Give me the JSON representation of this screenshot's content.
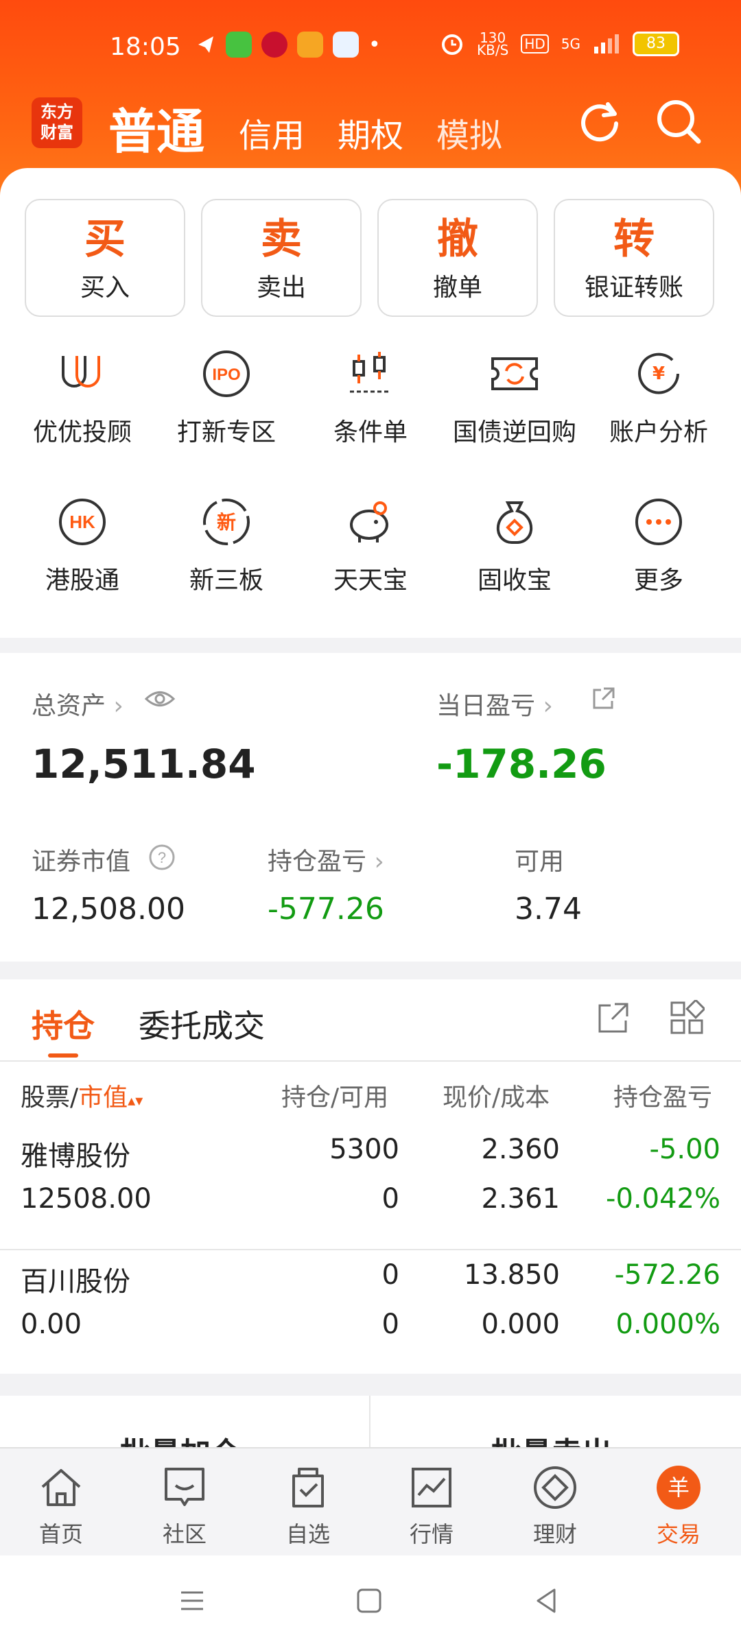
{
  "status_bar": {
    "time": "18:05",
    "net_speed_top": "130",
    "net_speed_unit": "KB/S",
    "hd": "HD",
    "signal": "5G",
    "battery": "83"
  },
  "topnav": {
    "logo": "东方财富",
    "tabs": [
      "普通",
      "信用",
      "期权",
      "模拟"
    ]
  },
  "actions": [
    {
      "big": "买",
      "label": "买入"
    },
    {
      "big": "卖",
      "label": "卖出"
    },
    {
      "big": "撤",
      "label": "撤单"
    },
    {
      "big": "转",
      "label": "银证转账"
    }
  ],
  "features_row1": [
    {
      "label": "优优投顾",
      "icon": "uu-advisor-icon"
    },
    {
      "label": "打新专区",
      "icon": "ipo-icon"
    },
    {
      "label": "条件单",
      "icon": "condition-order-icon"
    },
    {
      "label": "国债逆回购",
      "icon": "reverse-repo-icon"
    },
    {
      "label": "账户分析",
      "icon": "account-analysis-icon"
    }
  ],
  "features_row2": [
    {
      "label": "港股通",
      "icon": "hk-icon"
    },
    {
      "label": "新三板",
      "icon": "new-third-board-icon"
    },
    {
      "label": "天天宝",
      "icon": "piggy-bank-icon"
    },
    {
      "label": "固收宝",
      "icon": "money-bag-icon"
    },
    {
      "label": "更多",
      "icon": "more-icon"
    }
  ],
  "assets": {
    "total_label": "总资产",
    "total_value": "12,511.84",
    "daily_pl_label": "当日盈亏",
    "daily_pl_value": "-178.26",
    "market_value_label": "证券市值",
    "market_value": "12,508.00",
    "holding_pl_label": "持仓盈亏",
    "holding_pl": "-577.26",
    "available_label": "可用",
    "available": "3.74"
  },
  "positions": {
    "tabs": [
      "持仓",
      "委托成交"
    ],
    "headers": {
      "stock": "股票",
      "slash": "/",
      "market_value": "市值",
      "holding": "持仓/可用",
      "price": "现价/成本",
      "pl": "持仓盈亏"
    },
    "rows": [
      {
        "name": "雅博股份",
        "market_value": "12508.00",
        "holding": "5300",
        "available": "0",
        "price": "2.360",
        "cost": "2.361",
        "pl": "-5.00",
        "pl_pct": "-0.042%"
      },
      {
        "name": "百川股份",
        "market_value": "0.00",
        "holding": "0",
        "available": "0",
        "price": "13.850",
        "cost": "0.000",
        "pl": "-572.26",
        "pl_pct": "0.000%"
      }
    ]
  },
  "batch": {
    "left": "批量加仓",
    "right": "批量卖出"
  },
  "bottom_nav": [
    {
      "label": "首页",
      "icon": "home-icon"
    },
    {
      "label": "社区",
      "icon": "community-icon"
    },
    {
      "label": "自选",
      "icon": "watchlist-icon"
    },
    {
      "label": "行情",
      "icon": "market-icon"
    },
    {
      "label": "理财",
      "icon": "wealth-icon"
    },
    {
      "label": "交易",
      "icon": "trade-icon"
    }
  ],
  "colors": {
    "brand": "#ff5a12",
    "up": "#e8350d",
    "down": "#129b12",
    "active_tab": "#f25a16"
  }
}
